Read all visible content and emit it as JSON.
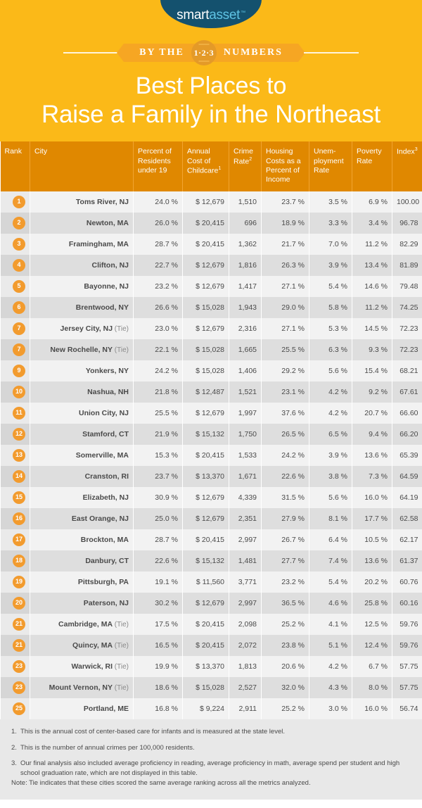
{
  "brand": {
    "logo_smart": "smart",
    "logo_asset": "asset",
    "logo_tm": "™",
    "navy": "#14516E",
    "light_blue": "#5FC3E4",
    "yellow": "#FBB918",
    "header_orange": "#E08800",
    "badge_orange": "#F29B2E",
    "ribbon_orange": "#F6A623"
  },
  "banner": {
    "left_text": "BY THE",
    "badge_text": "1·2·3",
    "right_text": "NUMBERS"
  },
  "hero": {
    "title_line1": "Best Places to",
    "title_line2": "Raise a Family in the Northeast"
  },
  "table": {
    "columns": [
      {
        "key": "rank",
        "label": "Rank",
        "sup": ""
      },
      {
        "key": "city",
        "label": "City",
        "sup": ""
      },
      {
        "key": "pct",
        "label": "Percent of Residents under 19",
        "sup": ""
      },
      {
        "key": "cost",
        "label": "Annual Cost of Childcare",
        "sup": "1"
      },
      {
        "key": "crime",
        "label": "Crime Rate",
        "sup": "2"
      },
      {
        "key": "house",
        "label": "Housing Costs as a Percent of Income",
        "sup": ""
      },
      {
        "key": "unemp",
        "label": "Unem- ployment Rate",
        "sup": ""
      },
      {
        "key": "pov",
        "label": "Poverty Rate",
        "sup": ""
      },
      {
        "key": "index",
        "label": "Index",
        "sup": "3"
      }
    ],
    "rows": [
      {
        "rank": "1",
        "city": "Toms River, NJ",
        "tie": "",
        "pct": "24.0 %",
        "cost": "$ 12,679",
        "crime": "1,510",
        "house": "23.7 %",
        "unemp": "3.5 %",
        "pov": "6.9 %",
        "index": "100.00"
      },
      {
        "rank": "2",
        "city": "Newton, MA",
        "tie": "",
        "pct": "26.0 %",
        "cost": "$ 20,415",
        "crime": "696",
        "house": "18.9 %",
        "unemp": "3.3 %",
        "pov": "3.4 %",
        "index": "96.78"
      },
      {
        "rank": "3",
        "city": "Framingham, MA",
        "tie": "",
        "pct": "28.7 %",
        "cost": "$ 20,415",
        "crime": "1,362",
        "house": "21.7 %",
        "unemp": "7.0 %",
        "pov": "11.2 %",
        "index": "82.29"
      },
      {
        "rank": "4",
        "city": "Clifton, NJ",
        "tie": "",
        "pct": "22.7 %",
        "cost": "$ 12,679",
        "crime": "1,816",
        "house": "26.3 %",
        "unemp": "3.9 %",
        "pov": "13.4 %",
        "index": "81.89"
      },
      {
        "rank": "5",
        "city": "Bayonne, NJ",
        "tie": "",
        "pct": "23.2 %",
        "cost": "$ 12,679",
        "crime": "1,417",
        "house": "27.1 %",
        "unemp": "5.4 %",
        "pov": "14.6 %",
        "index": "79.48"
      },
      {
        "rank": "6",
        "city": "Brentwood, NY",
        "tie": "",
        "pct": "26.6 %",
        "cost": "$ 15,028",
        "crime": "1,943",
        "house": "29.0 %",
        "unemp": "5.8 %",
        "pov": "11.2 %",
        "index": "74.25"
      },
      {
        "rank": "7",
        "city": "Jersey City, NJ",
        "tie": "(Tie)",
        "pct": "23.0 %",
        "cost": "$ 12,679",
        "crime": "2,316",
        "house": "27.1 %",
        "unemp": "5.3 %",
        "pov": "14.5 %",
        "index": "72.23"
      },
      {
        "rank": "7",
        "city": "New Rochelle, NY",
        "tie": "(Tie)",
        "pct": "22.1 %",
        "cost": "$ 15,028",
        "crime": "1,665",
        "house": "25.5 %",
        "unemp": "6.3 %",
        "pov": "9.3 %",
        "index": "72.23"
      },
      {
        "rank": "9",
        "city": "Yonkers, NY",
        "tie": "",
        "pct": "24.2 %",
        "cost": "$ 15,028",
        "crime": "1,406",
        "house": "29.2 %",
        "unemp": "5.6 %",
        "pov": "15.4 %",
        "index": "68.21"
      },
      {
        "rank": "10",
        "city": "Nashua, NH",
        "tie": "",
        "pct": "21.8 %",
        "cost": "$ 12,487",
        "crime": "1,521",
        "house": "23.1 %",
        "unemp": "4.2 %",
        "pov": "9.2 %",
        "index": "67.61"
      },
      {
        "rank": "11",
        "city": "Union City, NJ",
        "tie": "",
        "pct": "25.5 %",
        "cost": "$ 12,679",
        "crime": "1,997",
        "house": "37.6 %",
        "unemp": "4.2 %",
        "pov": "20.7 %",
        "index": "66.60"
      },
      {
        "rank": "12",
        "city": "Stamford, CT",
        "tie": "",
        "pct": "21.9 %",
        "cost": "$  15,132",
        "crime": "1,750",
        "house": "26.5 %",
        "unemp": "6.5 %",
        "pov": "9.4 %",
        "index": "66.20"
      },
      {
        "rank": "13",
        "city": "Somerville, MA",
        "tie": "",
        "pct": "15.3 %",
        "cost": "$ 20,415",
        "crime": "1,533",
        "house": "24.2 %",
        "unemp": "3.9 %",
        "pov": "13.6 %",
        "index": "65.39"
      },
      {
        "rank": "14",
        "city": "Cranston, RI",
        "tie": "",
        "pct": "23.7 %",
        "cost": "$ 13,370",
        "crime": "1,671",
        "house": "22.6 %",
        "unemp": "3.8 %",
        "pov": "7.3 %",
        "index": "64.59"
      },
      {
        "rank": "15",
        "city": "Elizabeth, NJ",
        "tie": "",
        "pct": "30.9 %",
        "cost": "$ 12,679",
        "crime": "4,339",
        "house": "31.5 %",
        "unemp": "5.6 %",
        "pov": "16.0 %",
        "index": "64.19"
      },
      {
        "rank": "16",
        "city": "East Orange, NJ",
        "tie": "",
        "pct": "25.0 %",
        "cost": "$ 12,679",
        "crime": "2,351",
        "house": "27.9 %",
        "unemp": "8.1 %",
        "pov": "17.7 %",
        "index": "62.58"
      },
      {
        "rank": "17",
        "city": "Brockton, MA",
        "tie": "",
        "pct": "28.7 %",
        "cost": "$ 20,415",
        "crime": "2,997",
        "house": "26.7 %",
        "unemp": "6.4 %",
        "pov": "10.5 %",
        "index": "62.17"
      },
      {
        "rank": "18",
        "city": "Danbury, CT",
        "tie": "",
        "pct": "22.6 %",
        "cost": "$  15,132",
        "crime": "1,481",
        "house": "27.7 %",
        "unemp": "7.4 %",
        "pov": "13.6 %",
        "index": "61.37"
      },
      {
        "rank": "19",
        "city": "Pittsburgh, PA",
        "tie": "",
        "pct": "19.1 %",
        "cost": "$ 11,560",
        "crime": "3,771",
        "house": "23.2 %",
        "unemp": "5.4 %",
        "pov": "20.2 %",
        "index": "60.76"
      },
      {
        "rank": "20",
        "city": "Paterson, NJ",
        "tie": "",
        "pct": "30.2 %",
        "cost": "$ 12,679",
        "crime": "2,997",
        "house": "36.5 %",
        "unemp": "4.6 %",
        "pov": "25.8 %",
        "index": "60.16"
      },
      {
        "rank": "21",
        "city": "Cambridge, MA",
        "tie": "(Tie)",
        "pct": "17.5 %",
        "cost": "$ 20,415",
        "crime": "2,098",
        "house": "25.2 %",
        "unemp": "4.1 %",
        "pov": "12.5 %",
        "index": "59.76"
      },
      {
        "rank": "21",
        "city": "Quincy, MA",
        "tie": "(Tie)",
        "pct": "16.5 %",
        "cost": "$ 20,415",
        "crime": "2,072",
        "house": "23.8 %",
        "unemp": "5.1 %",
        "pov": "12.4 %",
        "index": "59.76"
      },
      {
        "rank": "23",
        "city": "Warwick, RI",
        "tie": "(Tie)",
        "pct": "19.9 %",
        "cost": "$ 13,370",
        "crime": "1,813",
        "house": "20.6 %",
        "unemp": "4.2 %",
        "pov": "6.7 %",
        "index": "57.75"
      },
      {
        "rank": "23",
        "city": "Mount Vernon, NY",
        "tie": "(Tie)",
        "pct": "18.6 %",
        "cost": "$ 15,028",
        "crime": "2,527",
        "house": "32.0 %",
        "unemp": "4.3 %",
        "pov": "8.0 %",
        "index": "57.75"
      },
      {
        "rank": "25",
        "city": "Portland, ME",
        "tie": "",
        "pct": "16.8 %",
        "cost": "$  9,224",
        "crime": "2,911",
        "house": "25.2 %",
        "unemp": "3.0 %",
        "pov": "16.0 %",
        "index": "56.74"
      }
    ]
  },
  "footnotes": [
    {
      "num": "1.",
      "text": "This is the annual cost of center-based care for infants and is measured at the state level."
    },
    {
      "num": "2.",
      "text": "This is the number of annual crimes per 100,000 residents."
    },
    {
      "num": "3.",
      "text": "Our final analysis also included average proficiency in reading, average proficiency in math, average spend per student and high school graduation rate, which are not displayed in this table."
    }
  ],
  "note": "Note: Tie indicates that these cities scored the same average ranking across all the metrics analyzed."
}
